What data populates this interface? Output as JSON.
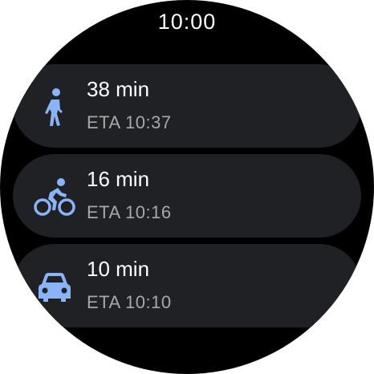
{
  "status": {
    "time": "10:00"
  },
  "colors": {
    "icon": "#8ab4f8",
    "chip_bg": "#202124",
    "secondary_text": "#a8a8a8"
  },
  "routes": [
    {
      "mode_icon": "walk-icon",
      "duration": "38 min",
      "eta": "ETA 10:37"
    },
    {
      "mode_icon": "bike-icon",
      "duration": "16 min",
      "eta": "ETA 10:16"
    },
    {
      "mode_icon": "car-icon",
      "duration": "10 min",
      "eta": "ETA 10:10"
    }
  ]
}
